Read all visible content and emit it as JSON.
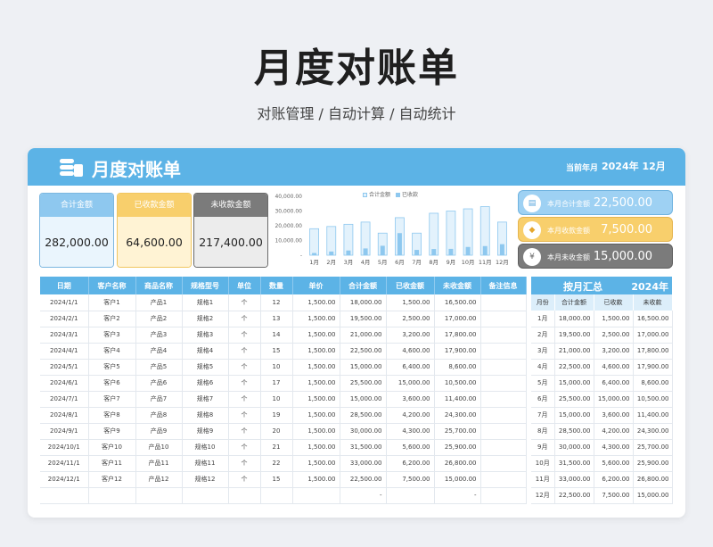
{
  "page": {
    "title": "月度对账单",
    "subtitle": "对账管理 / 自动计算 / 自动统计"
  },
  "header": {
    "title": "月度对账单",
    "period_label": "当前年月",
    "period_value": "2024年 12月"
  },
  "kpis": [
    {
      "label": "合计金额",
      "value": "282,000.00"
    },
    {
      "label": "已收款金额",
      "value": "64,600.00"
    },
    {
      "label": "未收款金额",
      "value": "217,400.00"
    }
  ],
  "month_cards": [
    {
      "label": "本月合计金额",
      "value": "22,500.00",
      "icon": "document-icon"
    },
    {
      "label": "本月收款金额",
      "value": "7,500.00",
      "icon": "money-icon"
    },
    {
      "label": "本月未收金额",
      "value": "15,000.00",
      "icon": "yen-icon"
    }
  ],
  "table": {
    "headers": [
      "日期",
      "客户名称",
      "商品名称",
      "规格型号",
      "单位",
      "数量",
      "单价",
      "合计金额",
      "已收金额",
      "未收金额",
      "备注信息"
    ],
    "rows": [
      [
        "2024/1/1",
        "客户1",
        "产品1",
        "规格1",
        "个",
        "12",
        "1,500.00",
        "18,000.00",
        "1,500.00",
        "16,500.00",
        ""
      ],
      [
        "2024/2/1",
        "客户2",
        "产品2",
        "规格2",
        "个",
        "13",
        "1,500.00",
        "19,500.00",
        "2,500.00",
        "17,000.00",
        ""
      ],
      [
        "2024/3/1",
        "客户3",
        "产品3",
        "规格3",
        "个",
        "14",
        "1,500.00",
        "21,000.00",
        "3,200.00",
        "17,800.00",
        ""
      ],
      [
        "2024/4/1",
        "客户4",
        "产品4",
        "规格4",
        "个",
        "15",
        "1,500.00",
        "22,500.00",
        "4,600.00",
        "17,900.00",
        ""
      ],
      [
        "2024/5/1",
        "客户5",
        "产品5",
        "规格5",
        "个",
        "10",
        "1,500.00",
        "15,000.00",
        "6,400.00",
        "8,600.00",
        ""
      ],
      [
        "2024/6/1",
        "客户6",
        "产品6",
        "规格6",
        "个",
        "17",
        "1,500.00",
        "25,500.00",
        "15,000.00",
        "10,500.00",
        ""
      ],
      [
        "2024/7/1",
        "客户7",
        "产品7",
        "规格7",
        "个",
        "10",
        "1,500.00",
        "15,000.00",
        "3,600.00",
        "11,400.00",
        ""
      ],
      [
        "2024/8/1",
        "客户8",
        "产品8",
        "规格8",
        "个",
        "19",
        "1,500.00",
        "28,500.00",
        "4,200.00",
        "24,300.00",
        ""
      ],
      [
        "2024/9/1",
        "客户9",
        "产品9",
        "规格9",
        "个",
        "20",
        "1,500.00",
        "30,000.00",
        "4,300.00",
        "25,700.00",
        ""
      ],
      [
        "2024/10/1",
        "客户10",
        "产品10",
        "规格10",
        "个",
        "21",
        "1,500.00",
        "31,500.00",
        "5,600.00",
        "25,900.00",
        ""
      ],
      [
        "2024/11/1",
        "客户11",
        "产品11",
        "规格11",
        "个",
        "22",
        "1,500.00",
        "33,000.00",
        "6,200.00",
        "26,800.00",
        ""
      ],
      [
        "2024/12/1",
        "客户12",
        "产品12",
        "规格12",
        "个",
        "15",
        "1,500.00",
        "22,500.00",
        "7,500.00",
        "15,000.00",
        ""
      ],
      [
        "",
        "",
        "",
        "",
        "",
        "",
        "",
        "-",
        "",
        "-",
        ""
      ]
    ]
  },
  "summary": {
    "title": "按月汇总",
    "year": "2024年",
    "headers": [
      "月份",
      "合计金额",
      "已收款",
      "未收款"
    ],
    "rows": [
      [
        "1月",
        "18,000.00",
        "1,500.00",
        "16,500.00"
      ],
      [
        "2月",
        "19,500.00",
        "2,500.00",
        "17,000.00"
      ],
      [
        "3月",
        "21,000.00",
        "3,200.00",
        "17,800.00"
      ],
      [
        "4月",
        "22,500.00",
        "4,600.00",
        "17,900.00"
      ],
      [
        "5月",
        "15,000.00",
        "6,400.00",
        "8,600.00"
      ],
      [
        "6月",
        "25,500.00",
        "15,000.00",
        "10,500.00"
      ],
      [
        "7月",
        "15,000.00",
        "3,600.00",
        "11,400.00"
      ],
      [
        "8月",
        "28,500.00",
        "4,200.00",
        "24,300.00"
      ],
      [
        "9月",
        "30,000.00",
        "4,300.00",
        "25,700.00"
      ],
      [
        "10月",
        "31,500.00",
        "5,600.00",
        "25,900.00"
      ],
      [
        "11月",
        "33,000.00",
        "6,200.00",
        "26,800.00"
      ],
      [
        "12月",
        "22,500.00",
        "7,500.00",
        "15,000.00"
      ]
    ]
  },
  "chart_data": {
    "type": "bar",
    "categories": [
      "1月",
      "2月",
      "3月",
      "4月",
      "5月",
      "6月",
      "7月",
      "8月",
      "9月",
      "10月",
      "11月",
      "12月"
    ],
    "series": [
      {
        "name": "合计金额",
        "values": [
          18000,
          19500,
          21000,
          22500,
          15000,
          25500,
          15000,
          28500,
          30000,
          31500,
          33000,
          22500
        ],
        "color": "#e3f2fc"
      },
      {
        "name": "已收款",
        "values": [
          1500,
          2500,
          3200,
          4600,
          6400,
          15000,
          3600,
          4200,
          4300,
          5600,
          6200,
          7500
        ],
        "color": "#8ec8ef"
      }
    ],
    "y_ticks": [
      "40,000.00",
      "30,000.00",
      "20,000.00",
      "10,000.00",
      "-"
    ],
    "ylim": [
      0,
      40000
    ],
    "legend": "top"
  },
  "colors": {
    "accent": "#5cb3e6",
    "gold": "#f8cf6c",
    "gray": "#7b7b7b"
  }
}
